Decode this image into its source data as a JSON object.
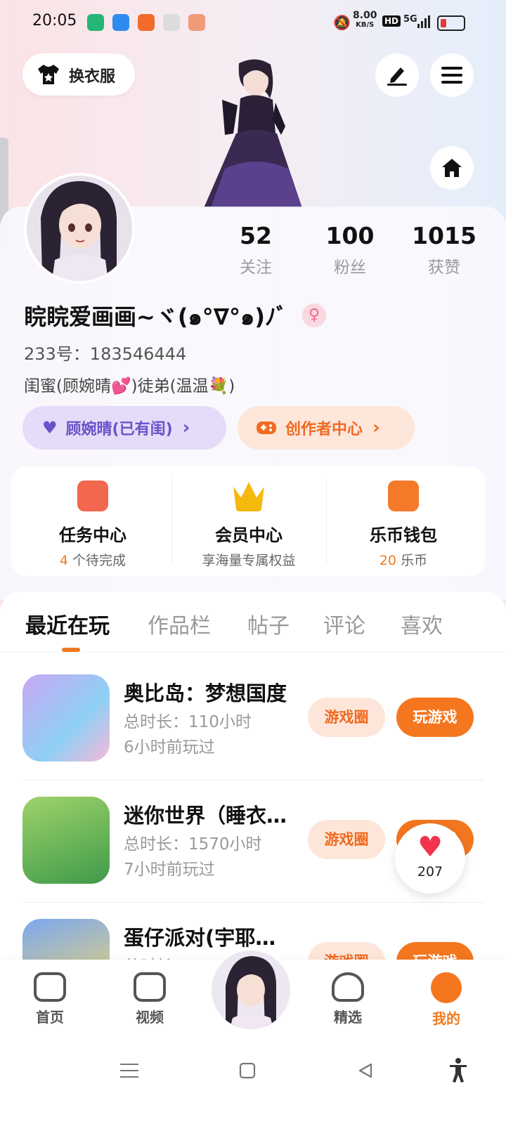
{
  "status_bar": {
    "time": "20:05",
    "net_speed": "8.00",
    "net_unit": "KB/S",
    "hd": "HD",
    "signal": "5G"
  },
  "header": {
    "change_clothes": "换衣服"
  },
  "profile": {
    "stats": [
      {
        "num": "52",
        "label": "关注"
      },
      {
        "num": "100",
        "label": "粉丝"
      },
      {
        "num": "1015",
        "label": "获赞"
      }
    ],
    "name": "睆睆爱画画~ヾ(๑°∇°๑)ﾉﾞ",
    "gender_symbol": "♀",
    "id_line": "233号：183546444",
    "bio": "闺蜜(顾婉晴💕)徒弟(温温💐)",
    "tag_bestie": "顾婉晴(已有闺)",
    "tag_creator": "创作者中心",
    "chevron": "›"
  },
  "quick": [
    {
      "title": "任务中心",
      "sub_num": "4",
      "sub_text": " 个待完成",
      "color": "#f2674e"
    },
    {
      "title": "会员中心",
      "sub_num": "",
      "sub_text": "享海量专属权益",
      "color": "#f5b90e"
    },
    {
      "title": "乐币钱包",
      "sub_num": "20",
      "sub_text": " 乐币",
      "color": "#f47a2a"
    }
  ],
  "tabs": [
    "最近在玩",
    "作品栏",
    "帖子",
    "评论",
    "喜欢"
  ],
  "games": [
    {
      "title": "奥比岛：梦想国度",
      "duration": "总时长：110小时",
      "last": "6小时前玩过",
      "circle_btn": "游戏圈",
      "play_btn": "玩游戏"
    },
    {
      "title": "迷你世界（睡衣…",
      "duration": "总时长：1570小时",
      "last": "7小时前玩过",
      "circle_btn": "游戏圈",
      "play_btn": "玩游戏"
    },
    {
      "title": "蛋仔派对(宇耶…",
      "duration": "总时长：",
      "last": "",
      "circle_btn": "游戏圈",
      "play_btn": "玩游戏"
    }
  ],
  "float_like": {
    "count": "207"
  },
  "bottom_nav": [
    {
      "label": "首页"
    },
    {
      "label": "视频"
    },
    {
      "label": "精选"
    },
    {
      "label": "我的"
    }
  ]
}
